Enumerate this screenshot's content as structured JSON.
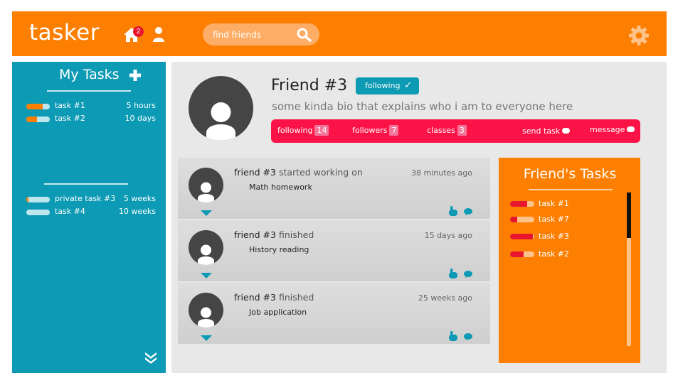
{
  "header": {
    "logo": "tasker",
    "notification_count": "2",
    "search_placeholder": "find friends",
    "icons": [
      "home-icon",
      "user-icon",
      "search-icon",
      "gear-icon"
    ]
  },
  "sidebar": {
    "title": "My Tasks",
    "tasks": [
      {
        "name": "task #1",
        "due": "5 hours",
        "progress": 0.7
      },
      {
        "name": "task #2",
        "due": "10 days",
        "progress": 0.45
      }
    ],
    "private_tasks": [
      {
        "name": "private task #3",
        "due": "5 weeks",
        "progress": 0.1
      },
      {
        "name": "task #4",
        "due": "10 weeks",
        "progress": 0.0
      }
    ]
  },
  "profile": {
    "name": "Friend #3",
    "following_label": "following",
    "bio": "some kinda bio that explains who i am to everyone here",
    "stats": {
      "following_label": "following",
      "following_count": "14",
      "followers_label": "followers",
      "followers_count": "7",
      "classes_label": "classes",
      "classes_count": "3",
      "send_task_label": "send task",
      "message_label": "message"
    }
  },
  "feed": [
    {
      "user": "friend #3",
      "action": " started working on",
      "task": "Math homework",
      "time": "38 minutes ago"
    },
    {
      "user": "friend #3",
      "action": " finished",
      "task": "History reading",
      "time": "15 days ago"
    },
    {
      "user": "friend #3",
      "action": " finished",
      "task": "Job application",
      "time": "25 weeks ago"
    }
  ],
  "friend_tasks": {
    "title": "Friend's Tasks",
    "tasks": [
      {
        "name": "task #1",
        "progress": 0.7
      },
      {
        "name": "task #7",
        "progress": 0.3
      },
      {
        "name": "task #3",
        "progress": 0.95
      },
      {
        "name": "task #2",
        "progress": 0.55
      }
    ]
  },
  "colors": {
    "orange": "#fd7f02",
    "teal": "#0d9ab4",
    "pink": "#fb1347",
    "red": "#e8152f",
    "panel_bg": "#e8e8e8"
  }
}
